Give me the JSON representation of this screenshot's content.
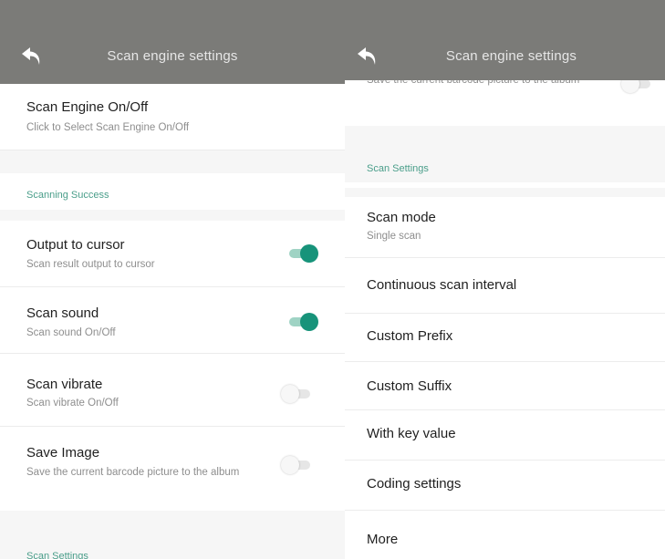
{
  "colors": {
    "toolbar": "#7b7b78",
    "accent": "#17937a",
    "section_header": "#4a9e8a"
  },
  "left": {
    "title": "Scan engine settings",
    "back_icon": "back-arrow-icon",
    "engine": {
      "title": "Scan Engine On/Off",
      "subtitle": "Click to Select Scan Engine On/Off"
    },
    "section_success": "Scanning Success",
    "output_cursor": {
      "title": "Output to cursor",
      "subtitle": "Scan result output to cursor",
      "enabled": true
    },
    "scan_sound": {
      "title": "Scan sound",
      "subtitle": "Scan sound On/Off",
      "enabled": true
    },
    "scan_vibrate": {
      "title": "Scan vibrate",
      "subtitle": "Scan vibrate On/Off",
      "enabled": false
    },
    "save_image": {
      "title": "Save Image",
      "subtitle": "Save the current barcode picture to the album",
      "enabled": false
    },
    "section_settings": "Scan Settings"
  },
  "right": {
    "title": "Scan engine settings",
    "back_icon": "back-arrow-icon",
    "save_image_partial": {
      "subtitle": "Save the current barcode picture to the album",
      "enabled": false
    },
    "section_settings": "Scan Settings",
    "scan_mode": {
      "title": "Scan mode",
      "subtitle": "Single scan"
    },
    "continuous_interval": {
      "title": "Continuous scan interval"
    },
    "custom_prefix": {
      "title": "Custom Prefix"
    },
    "custom_suffix": {
      "title": "Custom Suffix"
    },
    "with_key_value": {
      "title": "With key value"
    },
    "coding_settings": {
      "title": "Coding settings"
    },
    "more": {
      "title": "More"
    }
  }
}
